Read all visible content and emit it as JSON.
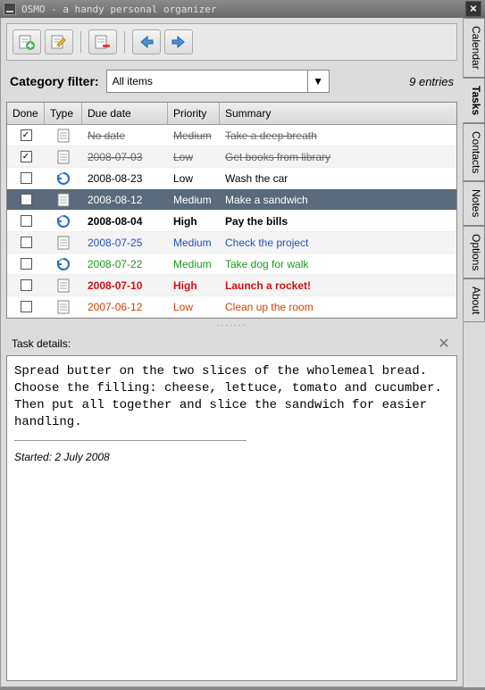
{
  "window": {
    "title": "OSMO - a handy personal organizer"
  },
  "side_tabs": [
    "Calendar",
    "Tasks",
    "Contacts",
    "Notes",
    "Options",
    "About"
  ],
  "toolbar": {
    "buttons": [
      "new-task",
      "edit-task",
      "delete-task",
      "prev",
      "next"
    ]
  },
  "filter": {
    "label": "Category filter:",
    "selected": "All items",
    "entries_text": "9 entries"
  },
  "columns": {
    "done": "Done",
    "type": "Type",
    "due": "Due date",
    "prio": "Priority",
    "summary": "Summary"
  },
  "tasks": [
    {
      "done": true,
      "type": "doc",
      "due": "No date",
      "prio": "Medium",
      "summary": "Take a deep breath",
      "style": "strike"
    },
    {
      "done": true,
      "type": "doc",
      "due": "2008-07-03",
      "prio": "Low",
      "summary": "Get books from library",
      "style": "strike"
    },
    {
      "done": false,
      "type": "recur",
      "due": "2008-08-23",
      "prio": "Low",
      "summary": "Wash the car",
      "style": ""
    },
    {
      "done": false,
      "type": "doc",
      "due": "2008-08-12",
      "prio": "Medium",
      "summary": "Make a sandwich",
      "style": "selected"
    },
    {
      "done": false,
      "type": "recur",
      "due": "2008-08-04",
      "prio": "High",
      "summary": "Pay the bills",
      "style": "bold"
    },
    {
      "done": false,
      "type": "doc",
      "due": "2008-07-25",
      "prio": "Medium",
      "summary": "Check the project",
      "style": "blue"
    },
    {
      "done": false,
      "type": "recur",
      "due": "2008-07-22",
      "prio": "Medium",
      "summary": "Take dog for walk",
      "style": "green"
    },
    {
      "done": false,
      "type": "doc",
      "due": "2008-07-10",
      "prio": "High",
      "summary": "Launch a rocket!",
      "style": "red bold"
    },
    {
      "done": false,
      "type": "doc",
      "due": "2007-06-12",
      "prio": "Low",
      "summary": "Clean up the room",
      "style": "orange"
    }
  ],
  "details": {
    "label": "Task details:",
    "body": "Spread butter on the two slices of the wholemeal bread. Choose the filling: cheese, lettuce, tomato and cucumber. Then put all together and slice the sandwich for easier handling.",
    "started": "Started: 2 July 2008"
  }
}
